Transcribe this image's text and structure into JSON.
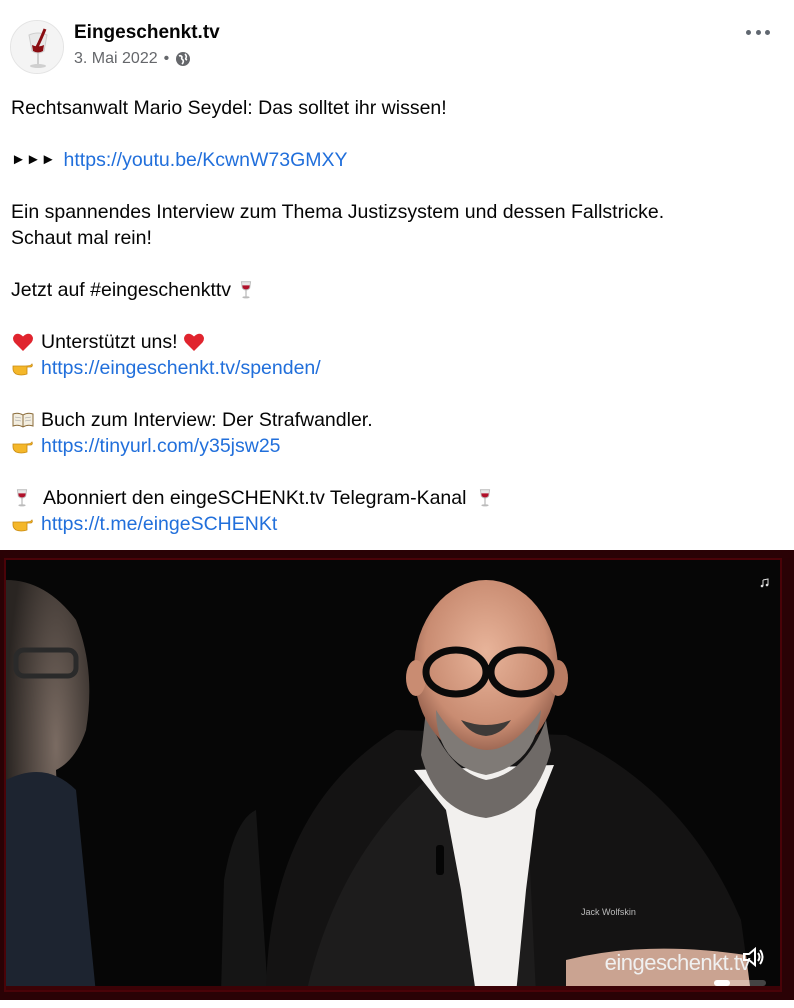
{
  "post": {
    "author": "Eingeschenkt.tv",
    "date": "3. Mai 2022",
    "separator": "•",
    "privacy_icon": "globe-icon",
    "more_icon": "more-options-icon"
  },
  "content": {
    "line1": "Rechtsanwalt Mario Seydel: Das solltet ihr wissen!",
    "arrows": "►►►",
    "link1": "https://youtu.be/KcwnW73GMXY",
    "line3a": "Ein spannendes Interview zum Thema Justizsystem und dessen Fallstricke.",
    "line3b": "Schaut mal rein!",
    "line4": "Jetzt auf #eingeschenkttv",
    "support": "Unterstützt uns!",
    "link2": "https://eingeschenkt.tv/spenden/",
    "book": "Buch zum Interview: Der Strafwandler.",
    "link3": "https://tinyurl.com/y35jsw25",
    "telegram": "Abonniert den eingeSCHENKt.tv Telegram-Kanal",
    "link4": "https://t.me/eingeSCHENKt"
  },
  "video": {
    "watermark": "eingeschenkt.tv",
    "jacket_logo": "Jack Wolfskin",
    "progress": 0.3
  },
  "colors": {
    "link": "#216fdb",
    "text": "#050505",
    "meta": "#65676b",
    "video_border": "#4a0308"
  }
}
